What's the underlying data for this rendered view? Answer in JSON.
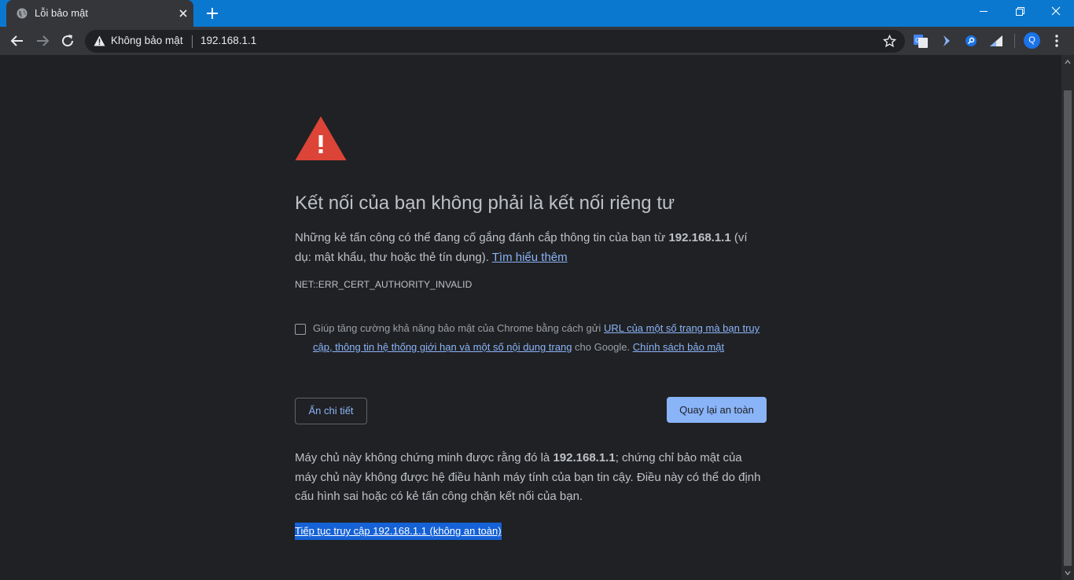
{
  "tab": {
    "title": "Lỗi bảo mật"
  },
  "toolbar": {
    "security_label": "Không bảo mật",
    "url": "192.168.1.1",
    "profile_initial": "Q"
  },
  "page": {
    "heading": "Kết nối của bạn không phải là kết nối riêng tư",
    "message_prefix": "Những kẻ tấn công có thể đang cố gắng đánh cắp thông tin của bạn từ ",
    "message_host": "192.168.1.1",
    "message_suffix": " (ví dụ: mật khẩu, thư hoặc thẻ tín dụng). ",
    "learn_more": "Tìm hiểu thêm",
    "error_code": "NET::ERR_CERT_AUTHORITY_INVALID",
    "optin_prefix": "Giúp tăng cường khả năng bảo mật của Chrome bằng cách gửi ",
    "optin_link": "URL của một số trang mà bạn truy cập, thông tin hệ thống giới hạn và một số nội dung trang",
    "optin_middle": " cho Google. ",
    "privacy_policy": "Chính sách bảo mật",
    "hide_details_button": "Ẩn chi tiết",
    "back_to_safety_button": "Quay lại an toàn",
    "details_prefix": "Máy chủ này không chứng minh được rằng đó là ",
    "details_host": "192.168.1.1",
    "details_suffix": "; chứng chỉ bảo mật của máy chủ này không được hệ điều hành máy tính của bạn tin cậy. Điều này có thể do định cấu hình sai hoặc có kẻ tấn công chặn kết nối của bạn.",
    "proceed_link": "Tiếp tục truy cập 192.168.1.1 (không an toàn)"
  },
  "colors": {
    "titlebar": "#0b78d0",
    "background": "#202124",
    "alert_red": "#db4437",
    "link_blue": "#8ab4f8"
  }
}
